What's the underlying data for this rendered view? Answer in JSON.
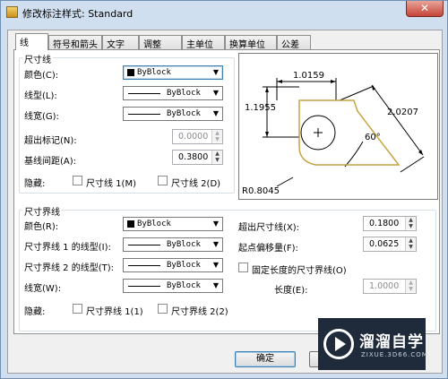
{
  "window": {
    "title": "修改标注样式: Standard",
    "close_label": "✕"
  },
  "tabs": [
    "线",
    "符号和箭头",
    "文字",
    "调整",
    "主单位",
    "换算单位",
    "公差"
  ],
  "dim_lines": {
    "group_title": "尺寸线",
    "color_label": "颜色(C):",
    "color_value": "ByBlock",
    "linetype_label": "线型(L):",
    "linetype_value": "ByBlock",
    "lineweight_label": "线宽(G):",
    "lineweight_value": "ByBlock",
    "extend_ticks_label": "超出标记(N):",
    "extend_ticks_value": "0.0000",
    "baseline_spacing_label": "基线间距(A):",
    "baseline_spacing_value": "0.3800",
    "suppress_label": "隐藏:",
    "suppress_1": "尺寸线 1(M)",
    "suppress_2": "尺寸线 2(D)"
  },
  "ext_lines": {
    "group_title": "尺寸界线",
    "color_label": "颜色(R):",
    "color_value": "ByBlock",
    "linetype1_label": "尺寸界线 1 的线型(I):",
    "linetype1_value": "ByBlock",
    "linetype2_label": "尺寸界线 2 的线型(T):",
    "linetype2_value": "ByBlock",
    "lineweight_label": "线宽(W):",
    "lineweight_value": "ByBlock",
    "suppress_label": "隐藏:",
    "suppress_1": "尺寸界线 1(1)",
    "suppress_2": "尺寸界线 2(2)",
    "extend_beyond_label": "超出尺寸线(X):",
    "extend_beyond_value": "0.1800",
    "offset_label": "起点偏移量(F):",
    "offset_value": "0.0625",
    "fixed_length_label": "固定长度的尺寸界线(O)",
    "length_label": "长度(E):",
    "length_value": "1.0000"
  },
  "preview": {
    "dim_top": "1.0159",
    "dim_left": "1.1955",
    "dim_right": "2.0207",
    "angle": "60°",
    "radius": "R0.8045"
  },
  "buttons": {
    "ok": "确定"
  },
  "watermark": {
    "name": "溜溜自学",
    "url": "ZIXUE.3D66.COM"
  }
}
